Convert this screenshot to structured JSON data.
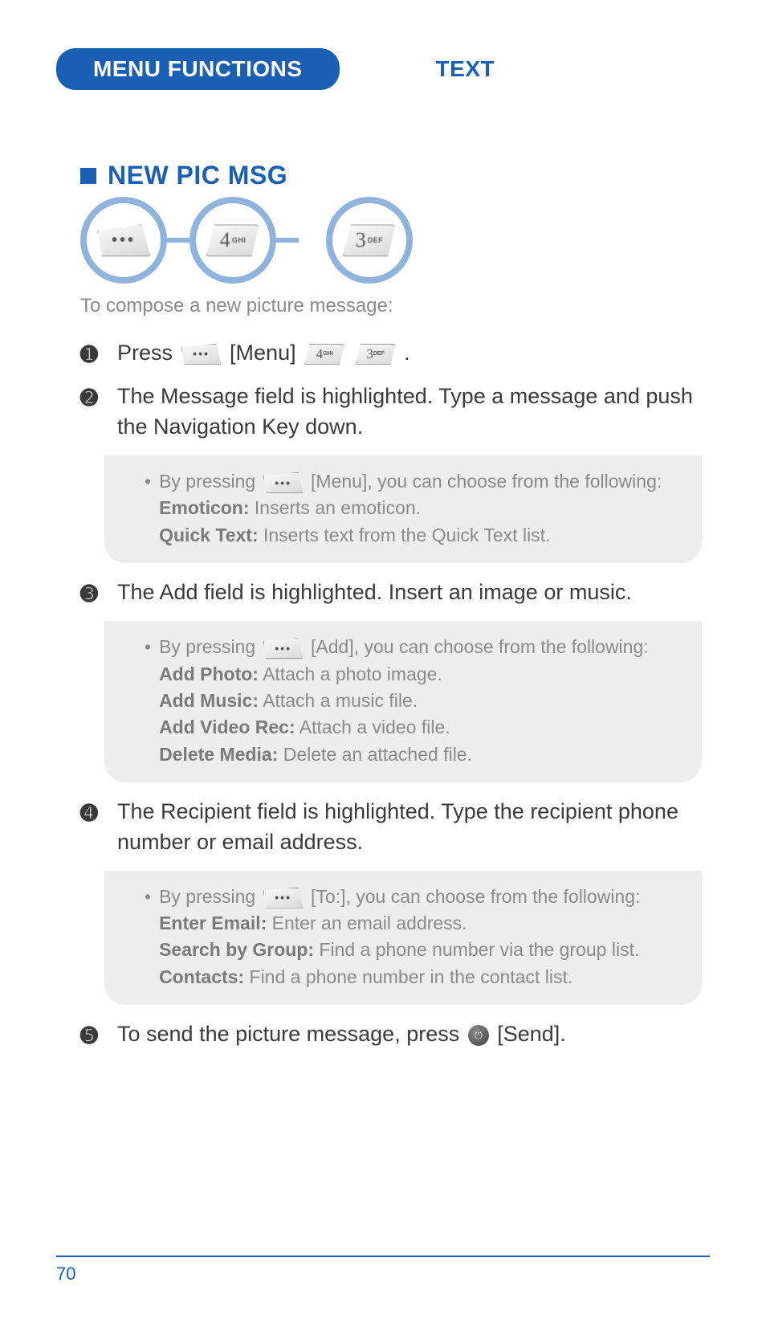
{
  "header": {
    "tab_menu": "MENU FUNCTIONS",
    "tab_text": "TEXT"
  },
  "section": {
    "title": "NEW PIC MSG",
    "keys": {
      "menu_dots": "•••",
      "k4_num": "4",
      "k4_sub": "GHI",
      "k3_num": "3",
      "k3_sub": "DEF"
    },
    "intro": "To compose a new picture message:"
  },
  "steps": {
    "s1": {
      "num": "➊",
      "t1": "Press ",
      "menu_label": " [Menu] ",
      "t2": " ."
    },
    "s2": {
      "num": "➋",
      "text": "The Message field is highlighted. Type a message and push the Navigation Key down."
    },
    "s3": {
      "num": "➌",
      "text": "The Add field is highlighted. Insert an image or music."
    },
    "s4": {
      "num": "➍",
      "text": "The Recipient field is highlighted. Type the recipient phone number or email address."
    },
    "s5": {
      "num": "➎",
      "t1": "To send the picture message, press ",
      "ok": "⏻",
      "t2": " [Send]."
    }
  },
  "notes": {
    "n1": {
      "lead": "By pressing ",
      "after": " [Menu], you can choose from the following:",
      "i1_b": "Emoticon:",
      "i1_t": " Inserts an emoticon.",
      "i2_b": "Quick Text:",
      "i2_t": " Inserts text from the Quick Text list."
    },
    "n2": {
      "lead": "By pressing ",
      "after": " [Add], you can choose from the following:",
      "i1_b": "Add Photo:",
      "i1_t": " Attach a photo image.",
      "i2_b": "Add Music:",
      "i2_t": " Attach a music file.",
      "i3_b": "Add Video Rec:",
      "i3_t": " Attach a video file.",
      "i4_b": "Delete Media:",
      "i4_t": " Delete an attached file."
    },
    "n3": {
      "lead": "By pressing ",
      "after": " [To:], you can choose from the following:",
      "i1_b": "Enter Email:",
      "i1_t": " Enter an email address.",
      "i2_b": "Search by Group:",
      "i2_t": " Find a phone number via the group list.",
      "i3_b": "Contacts:",
      "i3_t": " Find a phone number in the contact list."
    }
  },
  "footer": {
    "page": "70"
  }
}
